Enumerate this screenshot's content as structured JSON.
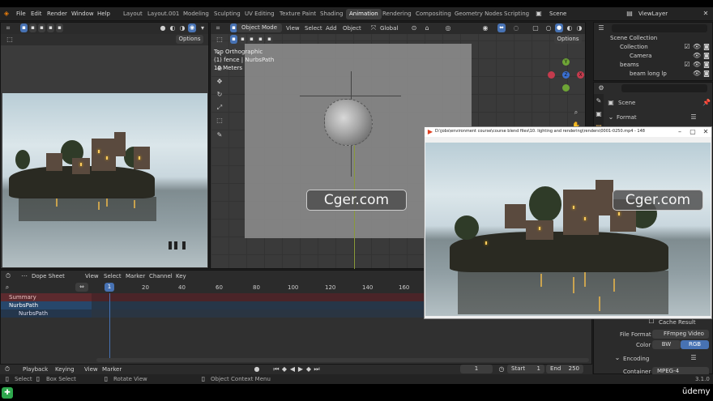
{
  "menu": {
    "items": [
      "File",
      "Edit",
      "Render",
      "Window",
      "Help"
    ],
    "workspaces": [
      "Layout",
      "Layout.001",
      "Modeling",
      "Sculpting",
      "UV Editing",
      "Texture Paint",
      "Shading",
      "Animation",
      "Rendering",
      "Compositing",
      "Geometry Nodes",
      "Scripting"
    ],
    "active_workspace": "Animation",
    "scene_label": "Scene",
    "viewlayer_label": "ViewLayer"
  },
  "left_viewport": {
    "options_label": "Options"
  },
  "center_viewport": {
    "mode_label": "Object Mode",
    "menus": [
      "View",
      "Select",
      "Add",
      "Object"
    ],
    "transform_label": "Global",
    "options_label": "Options",
    "overlay_lines": [
      "Top Orthographic",
      "(1) fence | NurbsPath",
      "10 Meters"
    ],
    "gizmo_axes": [
      "Y",
      "X",
      "Z"
    ]
  },
  "outliner": {
    "items": [
      "Scene Collection",
      "Collection",
      "Camera",
      "beams",
      "beam long lp"
    ]
  },
  "properties": {
    "scene_label": "Scene",
    "format_label": "Format",
    "cache_result_label": "Cache Result",
    "file_format_label": "File Format",
    "file_format_value": "FFmpeg Video",
    "color_label": "Color",
    "color_options": [
      "BW",
      "RGB"
    ],
    "active_color": "RGB",
    "encoding_label": "Encoding",
    "container_label": "Container",
    "container_value": "MPEG-4",
    "version": "3.1.0"
  },
  "dopesheet": {
    "editor_label": "Dope Sheet",
    "menus": [
      "View",
      "Select",
      "Marker",
      "Channel",
      "Key"
    ],
    "current_frame": "1",
    "frame_ticks": [
      "20",
      "40",
      "60",
      "80",
      "100",
      "120",
      "140",
      "160"
    ],
    "channels": [
      "Summary",
      "NurbsPath",
      "NurbsPath"
    ]
  },
  "playback": {
    "menus": [
      "Playback",
      "Keying",
      "View",
      "Marker"
    ],
    "current_frame": "1",
    "start_label": "Start",
    "start_value": "1",
    "end_label": "End",
    "end_value": "250"
  },
  "status": {
    "items": [
      "Select",
      "Box Select",
      "Rotate View",
      "Object Context Menu"
    ]
  },
  "video_player": {
    "title": "D:\\jobs\\environment course\\course blend files\\10. lighting and rendering\\renders\\0001-0250.mp4 - 148"
  },
  "watermarks": [
    "Cger.com",
    "Cger.com"
  ],
  "brand": "ūdemy",
  "colors": {
    "accent_blue": "#4772b3",
    "udemy_green": "#2ea84d",
    "summary_red": "#5c2a2e",
    "nurbs_blue": "#27476b"
  }
}
